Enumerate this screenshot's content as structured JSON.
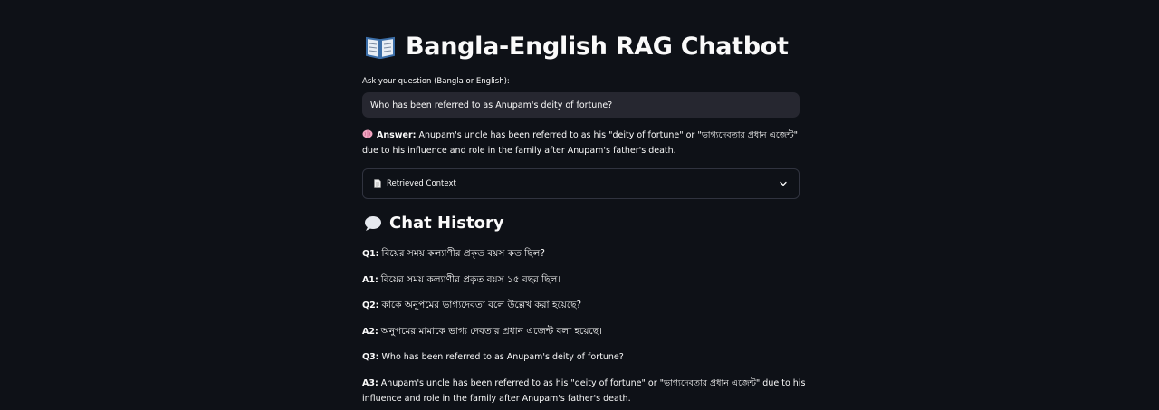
{
  "app": {
    "title": "Bangla-English RAG Chatbot",
    "title_icon": "open-book-icon"
  },
  "question": {
    "label": "Ask your question (Bangla or English):",
    "value": "Who has been referred to as Anupam's deity of fortune?"
  },
  "answer": {
    "icon": "brain-icon",
    "prefix": "Answer:",
    "text": "Anupam's uncle has been referred to as his \"deity of fortune\" or \"ভাগ্যদেবতার প্রধান এজেন্ট\" due to his influence and role in the family after Anupam's father's death."
  },
  "context": {
    "icon": "document-icon",
    "label": "Retrieved Context",
    "expanded": false
  },
  "history": {
    "icon": "speech-bubble-icon",
    "title": "Chat History",
    "items": [
      {
        "tag": "Q1:",
        "text": "বিয়ের সময় কল্যাণীর প্রকৃত বয়স কত ছিল?"
      },
      {
        "tag": "A1:",
        "text": "বিয়ের সময় কল্যাণীর প্রকৃত বয়স ১৫ বছর ছিল।"
      },
      {
        "tag": "Q2:",
        "text": "কাকে অনুপমের ভাগ্যদেবতা বলে উল্লেখ করা হয়েছে?"
      },
      {
        "tag": "A2:",
        "text": "অনুপমের মামাকে ভাগ্য দেবতার প্রধান এজেন্ট বলা হয়েছে।"
      },
      {
        "tag": "Q3:",
        "text": "Who has been referred to as Anupam's deity of fortune?"
      },
      {
        "tag": "A3:",
        "text": "Anupam's uncle has been referred to as his \"deity of fortune\" or \"ভাগ্যদেবতার প্রধান এজেন্ট\" due to his influence and role in the family after Anupam's father's death."
      }
    ]
  },
  "colors": {
    "background": "#0e1117",
    "input_background": "#262730",
    "border": "#30333f",
    "text": "#fafafa"
  }
}
